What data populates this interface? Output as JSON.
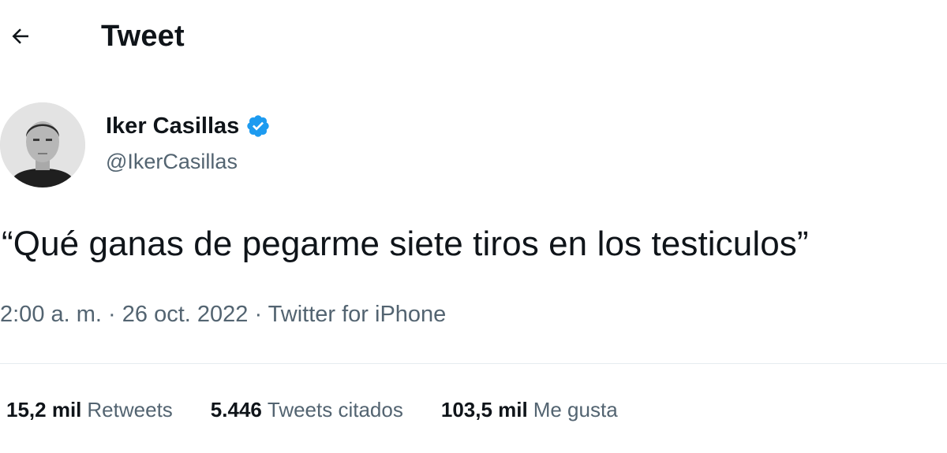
{
  "header": {
    "back_icon": "arrow-left-icon",
    "title": "Tweet"
  },
  "author": {
    "name": "Iker Casillas",
    "handle": "@IkerCasillas",
    "verified_icon": "verified-badge-icon",
    "verified_color": "#1d9bf0"
  },
  "tweet": {
    "text": "“Qué ganas de pegarme siete tiros en los testiculos”"
  },
  "meta": {
    "time": "2:00 a. m.",
    "separator": " · ",
    "date": "26 oct. 2022",
    "source": "Twitter for iPhone"
  },
  "stats": [
    {
      "value": "15,2 mil",
      "label": "Retweets"
    },
    {
      "value": "5.446",
      "label": "Tweets citados"
    },
    {
      "value": "103,5 mil",
      "label": "Me gusta"
    }
  ],
  "colors": {
    "text_primary": "#0f1419",
    "text_secondary": "#536471",
    "divider": "#e6ecf0"
  }
}
